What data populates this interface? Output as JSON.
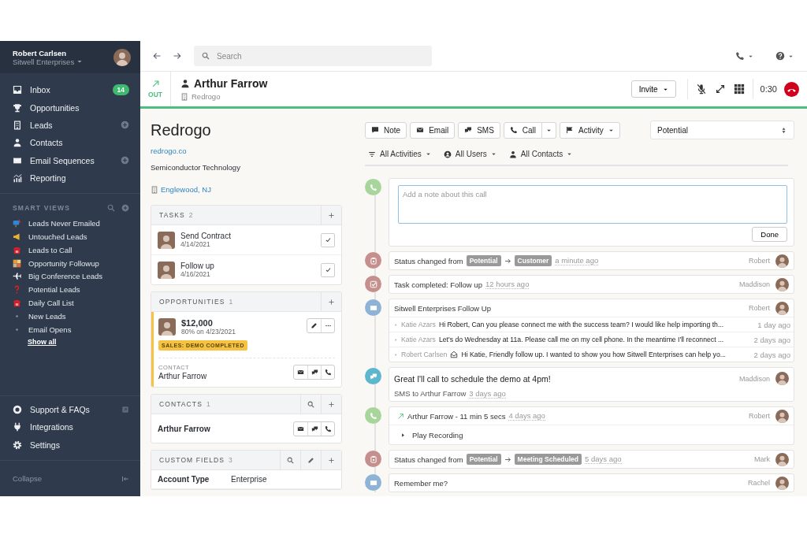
{
  "user": {
    "name": "Robert Carlsen",
    "org": "Sitwell Enterprises"
  },
  "nav": [
    {
      "label": "Inbox",
      "kind": "inbox",
      "badge": "14",
      "add_button": false
    },
    {
      "label": "Opportunities",
      "kind": "trophy",
      "add_button": false
    },
    {
      "label": "Leads",
      "kind": "building",
      "add_button": true
    },
    {
      "label": "Contacts",
      "kind": "person",
      "add_button": false
    },
    {
      "label": "Email Sequences",
      "kind": "mail",
      "add_button": true
    },
    {
      "label": "Reporting",
      "kind": "chart",
      "add_button": false
    }
  ],
  "smart_views": {
    "title": "SMART VIEWS",
    "items": [
      {
        "label": "Leads Never Emailed",
        "kind": "mailbox"
      },
      {
        "label": "Untouched Leads",
        "kind": "megaphone"
      },
      {
        "label": "Leads to Call",
        "kind": "telephone"
      },
      {
        "label": "Opportunity Followup",
        "kind": "puzzle"
      },
      {
        "label": "Big Conference Leads",
        "kind": "plane"
      },
      {
        "label": "Potential Leads",
        "kind": "question"
      },
      {
        "label": "Daily Call List",
        "kind": "telephone"
      },
      {
        "label": "New Leads",
        "kind": "dot"
      },
      {
        "label": "Email Opens",
        "kind": "dot"
      }
    ],
    "show_all": "Show all"
  },
  "footer_nav": [
    {
      "label": "Support & FAQs",
      "kind": "lifebuoy",
      "external": true
    },
    {
      "label": "Integrations",
      "kind": "plug",
      "external": false
    },
    {
      "label": "Settings",
      "kind": "gear",
      "external": false
    }
  ],
  "collapse": "Collapse",
  "search": {
    "placeholder": "Search"
  },
  "call": {
    "direction": "OUT",
    "contact": "Arthur Farrow",
    "company": "Redrogo",
    "invite": "Invite",
    "timer": "0:30"
  },
  "lead": {
    "name": "Redrogo",
    "url": "redrogo.co",
    "description": "Semiconductor Technology",
    "location": "Englewood, NJ"
  },
  "tasks": {
    "title": "TASKS",
    "count": "2",
    "items": [
      {
        "title": "Send Contract",
        "date": "4/14/2021"
      },
      {
        "title": "Follow up",
        "date": "4/16/2021"
      }
    ]
  },
  "opportunities": {
    "title": "OPPORTUNITIES",
    "count": "1",
    "value": "$12,000",
    "detail": "80% on 4/23/2021",
    "status": "SALES: DEMO COMPLETED",
    "contact_label": "CONTACT",
    "contact": "Arthur Farrow"
  },
  "contacts": {
    "title": "CONTACTS",
    "count": "1",
    "items": [
      {
        "name": "Arthur Farrow"
      }
    ]
  },
  "custom_fields": {
    "title": "CUSTOM FIELDS",
    "count": "3",
    "rows": [
      {
        "label": "Account Type",
        "value": "Enterprise"
      }
    ]
  },
  "actions": [
    {
      "label": "Note",
      "kind": "note"
    },
    {
      "label": "Email",
      "kind": "email"
    },
    {
      "label": "SMS",
      "kind": "sms"
    },
    {
      "label": "Call",
      "kind": "call"
    },
    {
      "label": "Activity",
      "kind": "activity"
    }
  ],
  "status_select": "Potential",
  "filters": [
    {
      "label": "All Activities",
      "kind": "activities"
    },
    {
      "label": "All Users",
      "kind": "users"
    },
    {
      "label": "All Contacts",
      "kind": "contacts"
    }
  ],
  "timeline": [
    {
      "kind": "note_editor",
      "placeholder": "Add a note about this call",
      "button": "Done"
    },
    {
      "kind": "status",
      "text": "Status changed from",
      "from": "Potential",
      "to": "Customer",
      "time": "a minute ago",
      "author": "Robert"
    },
    {
      "kind": "task",
      "text": "Task completed: Follow up",
      "time": "12 hours ago",
      "author": "Maddison"
    },
    {
      "kind": "email_thread",
      "subject": "Sitwell Enterprises Follow Up",
      "author": "Robert",
      "messages": [
        {
          "sender": "Katie Azars",
          "text": "Hi Robert, Can you please connect me with the success team? I would like help importing th...",
          "time": "1 day ago",
          "sent": false
        },
        {
          "sender": "Katie Azars",
          "text": "Let's do Wednesday at 11a. Please call me on my cell phone. In the meantime I'll reconnect ...",
          "time": "2 days ago",
          "sent": false
        },
        {
          "sender": "Robert Carlsen",
          "text": "Hi Katie, Friendly follow up. I wanted to show you how Sitwell Enterprises can help yo...",
          "time": "2 days ago",
          "sent": true
        }
      ]
    },
    {
      "kind": "sms",
      "text": "Great I'll call to schedule the demo at 4pm!",
      "meta": "SMS to Arthur Farrow",
      "time": "3 days ago",
      "author": "Maddison"
    },
    {
      "kind": "call",
      "text": "Arthur Farrow - 11 min 5 secs",
      "time": "4 days ago",
      "author": "Robert",
      "recording": "Play Recording"
    },
    {
      "kind": "status",
      "text": "Status changed from",
      "from": "Potential",
      "to": "Meeting Scheduled",
      "time": "5 days ago",
      "author": "Mark"
    },
    {
      "kind": "email",
      "subject": "Remember me?",
      "author": "Rachel"
    }
  ]
}
